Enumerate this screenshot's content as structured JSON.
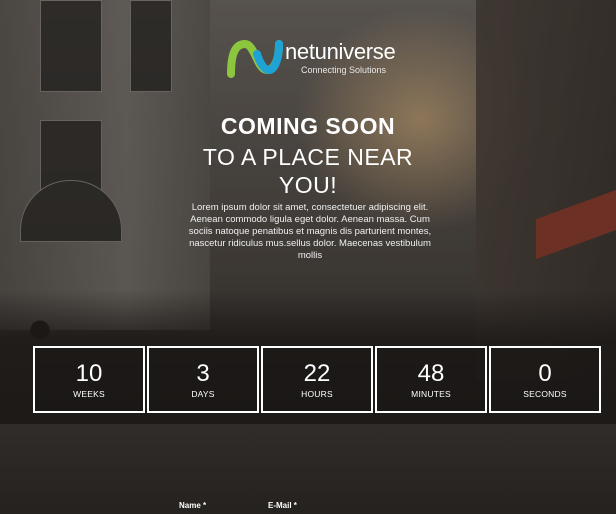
{
  "brand": {
    "name": "netuniverse",
    "tagline": "Connecting Solutions"
  },
  "hero": {
    "headline": "COMING SOON",
    "sub_line1": "TO A PLACE NEAR",
    "sub_line2": "YOU!",
    "description": "Lorem ipsum dolor sit amet, consectetuer adipiscing elit. Aenean commodo ligula eget dolor. Aenean massa. Cum sociis natoque penatibus et magnis dis parturient montes, nascetur ridiculus mus.sellus dolor. Maecenas vestibulum mollis"
  },
  "countdown": [
    {
      "value": "10",
      "unit": "WEEKS"
    },
    {
      "value": "3",
      "unit": "DAYS"
    },
    {
      "value": "22",
      "unit": "HOURS"
    },
    {
      "value": "48",
      "unit": "MINUTES"
    },
    {
      "value": "0",
      "unit": "SECONDS"
    }
  ],
  "form": {
    "name_label": "Name *",
    "email_label": "E-Mail *"
  },
  "colors": {
    "logo_green": "#8cc63f",
    "logo_blue": "#1fa3d6"
  },
  "icons": [
    "logo-mark-icon"
  ]
}
